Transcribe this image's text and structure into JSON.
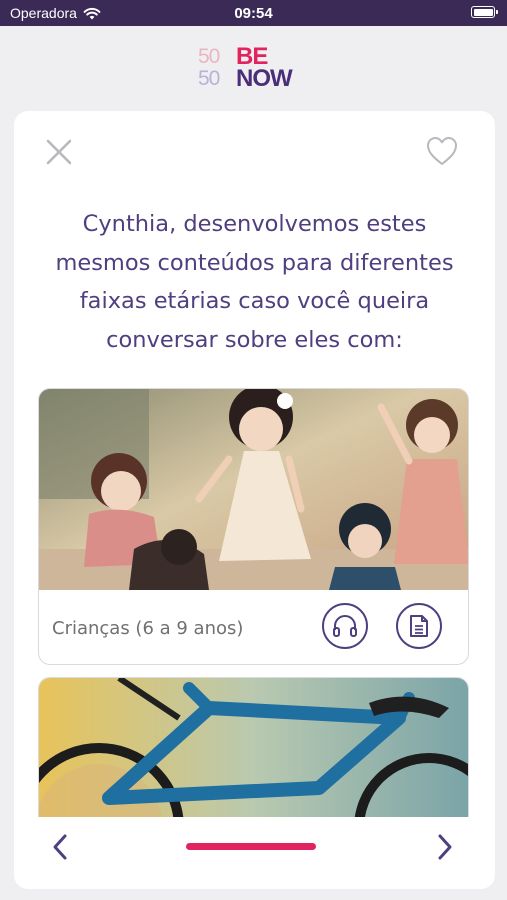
{
  "status_bar": {
    "carrier": "Operadora",
    "time": "09:54",
    "wifi_icon": "wifi-icon",
    "battery_icon": "battery-icon"
  },
  "logo": {
    "number_top": "50",
    "number_bottom": "50",
    "word_top": "BE",
    "word_bottom": "NOW"
  },
  "modal": {
    "close_icon": "close-icon",
    "favorite_icon": "heart-outline-icon",
    "headline": "Cynthia, desenvolvemos estes mesmos conteúdos para diferentes faixas etárias caso você queira conversar sobre eles com:"
  },
  "age_options": [
    {
      "label": "Crianças (6 a 9 anos)",
      "audio_icon": "headphones-icon",
      "text_icon": "document-icon"
    },
    {
      "label": ""
    }
  ],
  "pager": {
    "prev_icon": "chevron-left-icon",
    "next_icon": "chevron-right-icon",
    "progress": 0.5
  },
  "colors": {
    "status_bar": "#3a2a55",
    "accent_pink": "#e0245e",
    "brand_purple": "#4f3f80",
    "background": "#efeff2"
  }
}
